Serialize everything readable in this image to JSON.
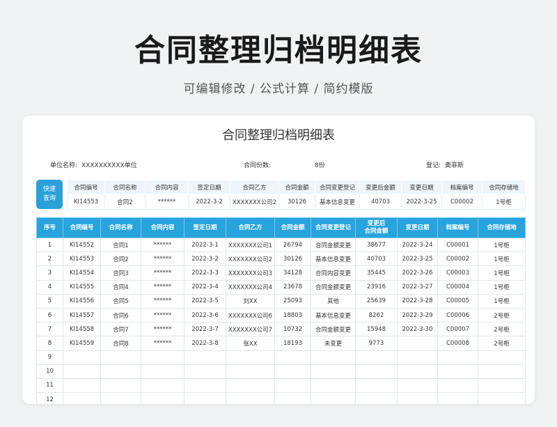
{
  "header": {
    "title": "合同整理归档明细表",
    "subtitle": "可编辑修改 /  公式计算  /  简约模版"
  },
  "sheet": {
    "title": "合同整理归档明细表",
    "unit_label": "单位名称:",
    "unit_value": "XXXXXXXXXX单位",
    "count_label": "合同份数:",
    "count_value": "8份",
    "register_label": "登记:",
    "register_value": "奥菲斯"
  },
  "quick_query": {
    "label_line1": "快速",
    "label_line2": "查询"
  },
  "lookup": {
    "headers": [
      "合同编号",
      "合同名称",
      "合同内容",
      "签定日期",
      "合同乙方",
      "合同金额",
      "合同变更登记",
      "变更后金额",
      "变更日期",
      "档案编号",
      "合同存储地"
    ],
    "values": [
      "KI14553",
      "合同2",
      "******",
      "2022-3-2",
      "XXXXXXX公司2",
      "30126",
      "基本信息变更",
      "40703",
      "2022-3-25",
      "C00002",
      "1号柜"
    ]
  },
  "table": {
    "headers": [
      "序号",
      "合同编号",
      "合同名称",
      "合同内容",
      "签定日期",
      "合同乙方",
      "合同金额",
      "合同变更登记",
      "变更后\n合同金额",
      "变更日期",
      "档案编号",
      "合同存储地"
    ],
    "rows": [
      [
        "1",
        "KI14552",
        "合同1",
        "******",
        "2022-3-1",
        "XXXXXXX公司1",
        "26794",
        "合同金额变更",
        "38677",
        "2022-3-24",
        "C00001",
        "1号柜"
      ],
      [
        "2",
        "KI14553",
        "合同2",
        "******",
        "2022-3-2",
        "XXXXXXX公司2",
        "30126",
        "基本信息变更",
        "40703",
        "2022-3-25",
        "C00002",
        "1号柜"
      ],
      [
        "3",
        "KI14554",
        "合同3",
        "******",
        "2022-3-3",
        "XXXXXXX公司3",
        "34128",
        "合同内容变更",
        "35445",
        "2022-3-26",
        "C00003",
        "1号柜"
      ],
      [
        "4",
        "KI14555",
        "合同4",
        "******",
        "2022-3-4",
        "XXXXXXX公司4",
        "23678",
        "合同金额变更",
        "23916",
        "2022-3-27",
        "C00004",
        "1号柜"
      ],
      [
        "5",
        "KI14556",
        "合同5",
        "******",
        "2022-3-5",
        "刘XX",
        "25093",
        "其他",
        "25639",
        "2022-3-28",
        "C00005",
        "1号柜"
      ],
      [
        "6",
        "KI14557",
        "合同6",
        "******",
        "2022-3-6",
        "XXXXXXX公司6",
        "18803",
        "基本信息变更",
        "8262",
        "2022-3-29",
        "C00006",
        "2号柜"
      ],
      [
        "7",
        "KI14558",
        "合同7",
        "******",
        "2022-3-7",
        "XXXXXXX公司7",
        "10732",
        "合同金额变更",
        "15948",
        "2022-3-30",
        "C00007",
        "2号柜"
      ],
      [
        "8",
        "KI14559",
        "合同8",
        "******",
        "2022-3-8",
        "张XX",
        "18193",
        "未变更",
        "9773",
        "",
        "C00008",
        "2号柜"
      ],
      [
        "9",
        "",
        "",
        "",
        "",
        "",
        "",
        "",
        "",
        "",
        "",
        ""
      ],
      [
        "10",
        "",
        "",
        "",
        "",
        "",
        "",
        "",
        "",
        "",
        "",
        ""
      ],
      [
        "11",
        "",
        "",
        "",
        "",
        "",
        "",
        "",
        "",
        "",
        "",
        ""
      ],
      [
        "12",
        "",
        "",
        "",
        "",
        "",
        "",
        "",
        "",
        "",
        "",
        ""
      ]
    ]
  },
  "colors": {
    "header_blue": "#27a3dd",
    "amount_red": "#e03a3a"
  }
}
